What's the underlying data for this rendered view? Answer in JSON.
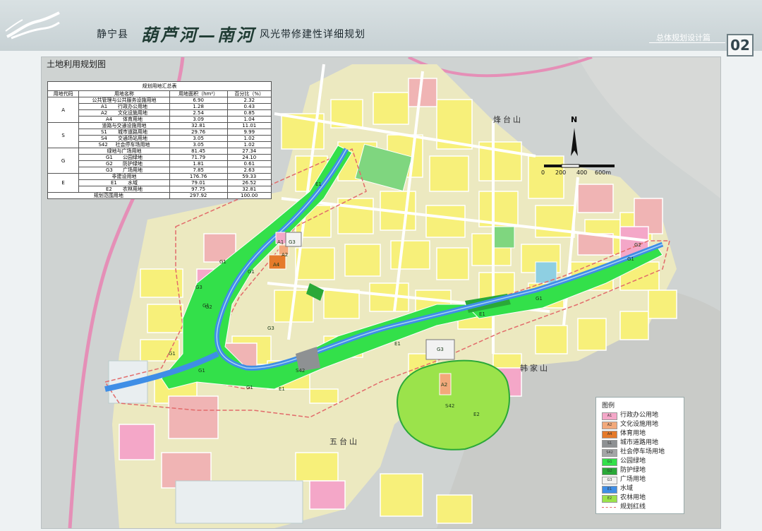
{
  "header": {
    "county": "静宁县",
    "river_name": "葫芦河—南河",
    "plan_title": "风光带修建性详细规划",
    "section": "总体规划设计篇",
    "page_number": "02"
  },
  "map": {
    "title": "土地利用规划图",
    "places": {
      "fenghuang_shan": "烽台山",
      "hanjia_shan": "韩家山",
      "wutai_shan": "五台山"
    },
    "north_label": "N",
    "scale": {
      "labels": [
        "0",
        "200",
        "400",
        "600m"
      ]
    },
    "zone_labels": [
      "E1",
      "G1",
      "G1",
      "G1",
      "G1",
      "G1",
      "G1",
      "G2",
      "G3",
      "G3",
      "A1",
      "G3",
      "A2",
      "A4",
      "S42",
      "G3",
      "A2",
      "S42",
      "E2",
      "E1",
      "E1",
      "E1",
      "G1",
      "G1",
      "G2"
    ],
    "colors": {
      "admin": "#f4a7c8",
      "culture": "#f2a97b",
      "sports": "#e57a2a",
      "road": "#8e9193",
      "parking": "#a3a5a6",
      "park": "#33e04a",
      "buffer": "#2aa838",
      "square": "#f2f2f2",
      "water": "#3f8ee6",
      "farm": "#9be34b",
      "residential": "#f7f07a",
      "commercial": "#f0b4b4"
    }
  },
  "summary": {
    "caption": "规划用地汇总表",
    "headers": [
      "用地代码",
      "用地名称",
      "用地面积（hm²）",
      "百分比（%）"
    ],
    "rows": [
      {
        "code": "A",
        "sub": "",
        "name": "公共管理与公共服务设施用地",
        "area": "6.90",
        "pct": "2.32"
      },
      {
        "code": "",
        "sub": "A1",
        "name": "行政办公用地",
        "area": "1.28",
        "pct": "0.43"
      },
      {
        "code": "",
        "sub": "A2",
        "name": "文化设施用地",
        "area": "2.54",
        "pct": "0.85"
      },
      {
        "code": "",
        "sub": "A4",
        "name": "体育用地",
        "area": "3.09",
        "pct": "1.04"
      },
      {
        "code": "S",
        "sub": "",
        "name": "道路与交通设施用地",
        "area": "32.81",
        "pct": "11.01"
      },
      {
        "code": "",
        "sub": "S1",
        "name": "城市道路用地",
        "area": "29.76",
        "pct": "9.99"
      },
      {
        "code": "",
        "sub": "S4",
        "name": "交通场站用地",
        "area": "3.05",
        "pct": "1.02"
      },
      {
        "code": "",
        "sub": "S42",
        "name": "社会停车场用地",
        "area": "3.05",
        "pct": "1.02"
      },
      {
        "code": "G",
        "sub": "",
        "name": "绿地与广场用地",
        "area": "81.45",
        "pct": "27.34"
      },
      {
        "code": "",
        "sub": "G1",
        "name": "公园绿地",
        "area": "71.79",
        "pct": "24.10"
      },
      {
        "code": "",
        "sub": "G2",
        "name": "防护绿地",
        "area": "1.81",
        "pct": "0.61"
      },
      {
        "code": "",
        "sub": "G3",
        "name": "广场用地",
        "area": "7.85",
        "pct": "2.63"
      },
      {
        "code": "E",
        "sub": "",
        "name": "非建设用地",
        "area": "176.76",
        "pct": "59.33"
      },
      {
        "code": "",
        "sub": "E1",
        "name": "水域",
        "area": "79.01",
        "pct": "26.52"
      },
      {
        "code": "",
        "sub": "E2",
        "name": "农林用地",
        "area": "97.75",
        "pct": "32.81"
      }
    ],
    "total": {
      "name": "规划范围用地",
      "area": "297.92",
      "pct": "100.00"
    }
  },
  "legend": {
    "title": "图例",
    "items": [
      {
        "code": "A1",
        "label": "行政办公用地",
        "color": "#f4a7c8"
      },
      {
        "code": "A2",
        "label": "文化设施用地",
        "color": "#f2a97b"
      },
      {
        "code": "A4",
        "label": "体育用地",
        "color": "#e57a2a"
      },
      {
        "code": "S1",
        "label": "城市道路用地",
        "color": "#8e9193"
      },
      {
        "code": "S42",
        "label": "社会停车场用地",
        "color": "#a3a5a6"
      },
      {
        "code": "G1",
        "label": "公园绿地",
        "color": "#33e04a"
      },
      {
        "code": "G2",
        "label": "防护绿地",
        "color": "#2aa838"
      },
      {
        "code": "G3",
        "label": "广场用地",
        "color": "#f2f2f2"
      },
      {
        "code": "E1",
        "label": "水域",
        "color": "#3f8ee6"
      },
      {
        "code": "E2",
        "label": "农林用地",
        "color": "#9be34b"
      },
      {
        "code": "",
        "label": "规划红线",
        "color": "#ffffff"
      }
    ]
  }
}
